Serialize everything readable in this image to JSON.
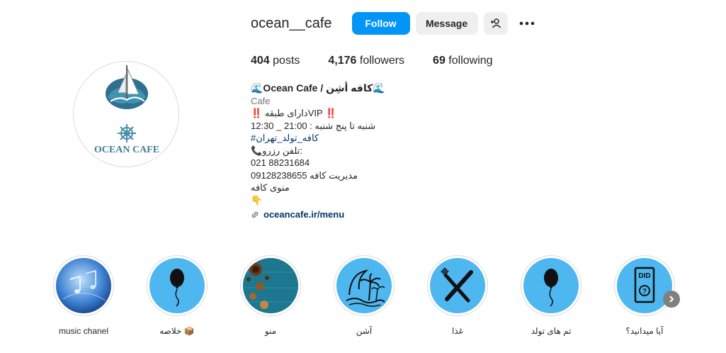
{
  "profile": {
    "username": "ocean__cafe",
    "follow_label": "Follow",
    "message_label": "Message",
    "avatar_text": "OCEAN CAFE",
    "colors": {
      "primary_button": "#0095f6",
      "secondary_button": "#efefef",
      "link": "#00376b"
    }
  },
  "stats": {
    "posts_count": "404",
    "posts_label": "posts",
    "followers_count": "4,176",
    "followers_label": "followers",
    "following_count": "69",
    "following_label": "following"
  },
  "bio": {
    "name": "🌊Ocean Cafe / کافه أشِن🌊",
    "category": "Cafe",
    "line1": "‼️ دارای طبقهVIP ‼️",
    "line2": "شنبه تا پنج شنبه : 21:00 _ 12:30",
    "hashtag": "#کافه_تولد_تهران",
    "line4": "📞تلفن رزرو:",
    "line5": "021 88231684",
    "line6": "09128238655 مدیریت کافه",
    "line7": "منوی کافه",
    "line8": "👇",
    "link": "oceancafe.ir/menu"
  },
  "highlights": [
    {
      "label": "music chanel",
      "icon": "music-notes"
    },
    {
      "label": "خلاصه 📦",
      "icon": "balloon"
    },
    {
      "label": "منو",
      "icon": "coffee-table"
    },
    {
      "label": "آشن",
      "icon": "palm-wave"
    },
    {
      "label": "غذا",
      "icon": "fork-knife"
    },
    {
      "label": "تم های تولد",
      "icon": "balloon"
    },
    {
      "label": "آیا میدانید؟",
      "icon": "did-you-know"
    }
  ]
}
